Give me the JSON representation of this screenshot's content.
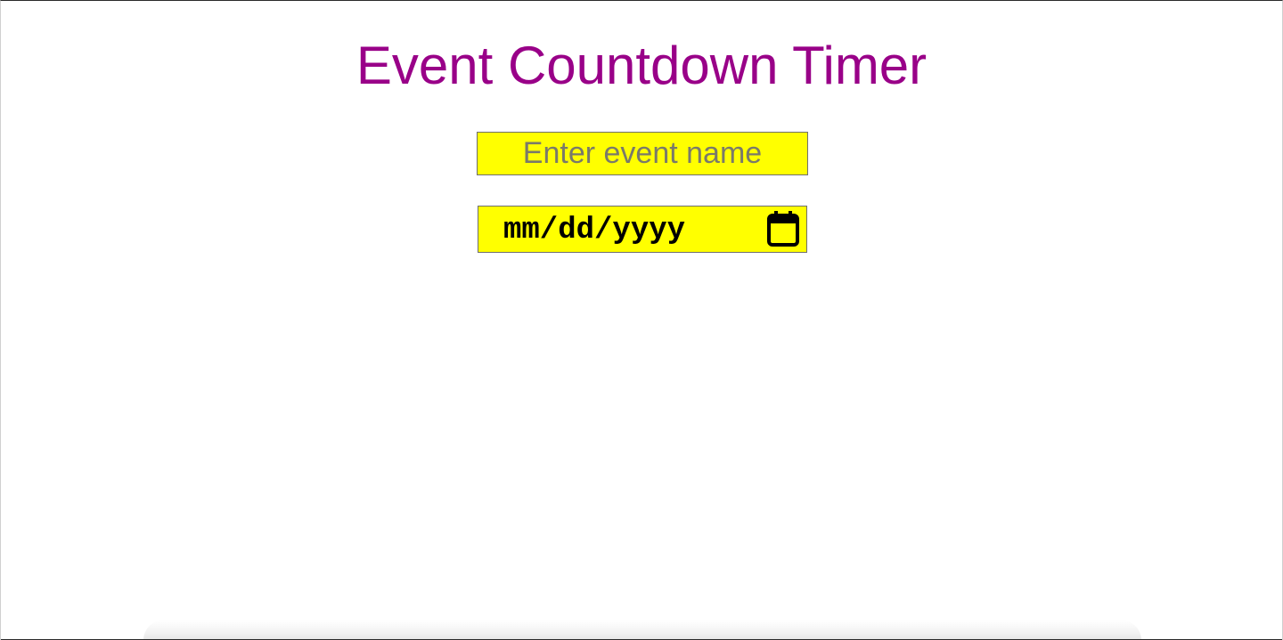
{
  "page": {
    "title": "Event Countdown Timer",
    "title_color": "#990088"
  },
  "form": {
    "event_name": {
      "placeholder": "Enter event name",
      "value": ""
    },
    "event_date": {
      "display": "mm/dd/yyyy",
      "icon": "calendar-icon"
    },
    "field_background": "#ffff00"
  }
}
